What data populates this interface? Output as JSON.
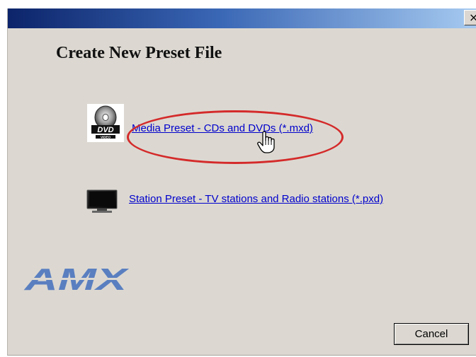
{
  "dialog": {
    "title_bar": {
      "close_label": "×"
    },
    "heading": "Create New Preset File",
    "options": [
      {
        "icon": "dvd-video-icon",
        "label": "Media Preset - CDs and DVDs (*.mxd)"
      },
      {
        "icon": "television-icon",
        "label": "Station Preset - TV stations and Radio stations (*.pxd)"
      }
    ],
    "logo": {
      "text": "AMX",
      "color": "#5a7fc0"
    },
    "cancel_label": "Cancel"
  },
  "annotation": {
    "highlight_color": "#d42a2a",
    "cursor": "hand-pointer-icon"
  }
}
